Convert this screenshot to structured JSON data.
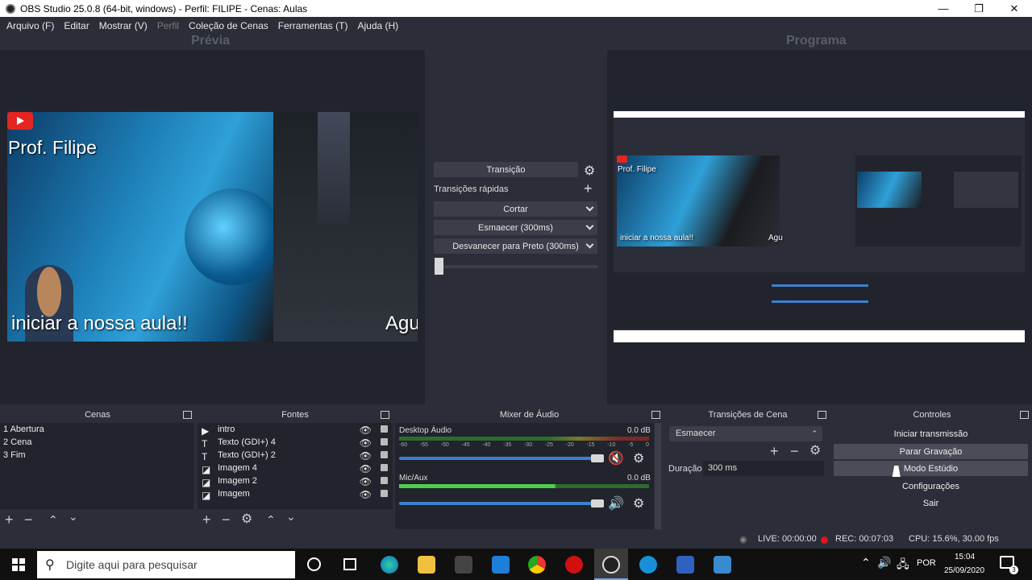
{
  "window": {
    "title": "OBS Studio 25.0.8 (64-bit, windows) - Perfil: FILIPE - Cenas: Aulas",
    "minimize": "—",
    "maximize": "❐",
    "close": "✕"
  },
  "menu": [
    "Arquivo (F)",
    "Editar",
    "Mostrar (V)",
    "Perfil",
    "Coleção de Cenas",
    "Ferramentas (T)",
    "Ajuda (H)"
  ],
  "headers": {
    "preview": "Prévia",
    "program": "Programa"
  },
  "preview": {
    "name": "Prof. Filipe",
    "caption": "iniciar a nossa aula!!",
    "cut_text": "Agu"
  },
  "transition_panel": {
    "transition_button": "Transição",
    "quick_label": "Transições rápidas",
    "cut": "Cortar",
    "fade": "Esmaecer (300ms)",
    "fade_black": "Desvanecer para Preto (300ms)"
  },
  "docks": {
    "scenes": "Cenas",
    "sources": "Fontes",
    "mixer": "Mixer de Áudio",
    "transitions": "Transições de Cena",
    "controls": "Controles"
  },
  "scenes": [
    "1 Abertura",
    "2 Cena",
    "3 Fim"
  ],
  "sources": [
    {
      "name": "intro",
      "icon": "▶"
    },
    {
      "name": "Texto (GDI+) 4",
      "icon": "T"
    },
    {
      "name": "Texto (GDI+) 2",
      "icon": "T"
    },
    {
      "name": "Imagem 4",
      "icon": "◪"
    },
    {
      "name": "Imagem 2",
      "icon": "◪"
    },
    {
      "name": "Imagem",
      "icon": "◪"
    }
  ],
  "mixer": {
    "desktop": {
      "name": "Desktop Áudio",
      "db": "0.0 dB"
    },
    "mic": {
      "name": "Mic/Aux",
      "db": "0.0 dB"
    },
    "ticks": [
      "-60",
      "-55",
      "-50",
      "-45",
      "-40",
      "-35",
      "-30",
      "-25",
      "-20",
      "-15",
      "-10",
      "-5",
      "0"
    ]
  },
  "scene_transitions": {
    "selected": "Esmaecer",
    "duration_label": "Duração",
    "duration_value": "300 ms"
  },
  "controls": [
    "Iniciar transmissão",
    "Parar Gravação",
    "Modo Estúdio",
    "Configurações",
    "Sair"
  ],
  "status": {
    "live": "LIVE: 00:00:00",
    "rec": "REC: 00:07:03",
    "cpu": "CPU: 15.6%, 30.00 fps"
  },
  "taskbar": {
    "search_placeholder": "Digite aqui para pesquisar",
    "lang": "POR",
    "time": "15:04",
    "date": "25/09/2020",
    "notif_count": "3"
  },
  "colors": {
    "accent": "#3d7fd0",
    "rec": "#e0141e",
    "mute": "#e02020"
  }
}
